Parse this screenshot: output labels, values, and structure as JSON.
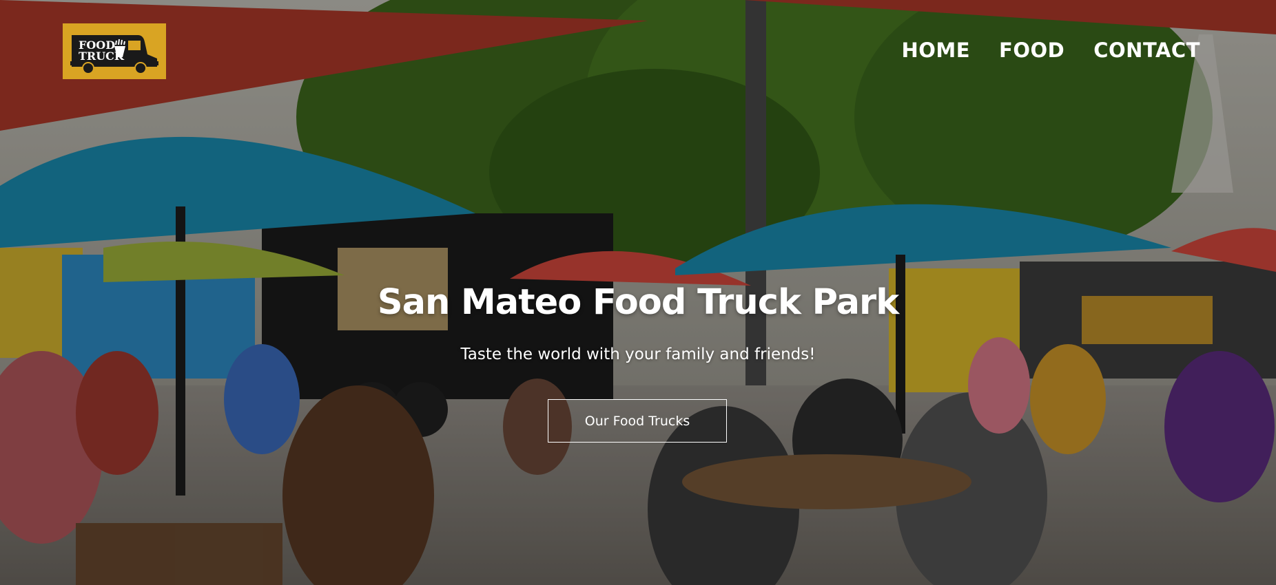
{
  "site": {
    "logo_text_line1": "FOOD",
    "logo_text_line2": "TRUCK",
    "logo_color": "#d9a423"
  },
  "nav": {
    "items": [
      {
        "label": "HOME"
      },
      {
        "label": "FOOD"
      },
      {
        "label": "CONTACT"
      }
    ]
  },
  "hero": {
    "title": "San Mateo Food Truck Park",
    "subtitle": "Taste the world with your family and friends!",
    "cta_label": "Our Food Trucks",
    "background": "photo of an outdoor food truck park with umbrellas and diners"
  },
  "colors": {
    "text": "#ffffff",
    "awning": "#b03a2a",
    "umbrella": "#1a8fb3"
  }
}
